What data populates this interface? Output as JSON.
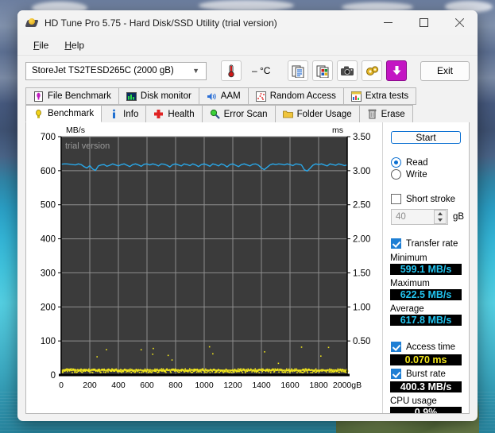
{
  "window": {
    "title": "HD Tune Pro 5.75 - Hard Disk/SSD Utility (trial version)",
    "app_icon": "hard-disk-icon",
    "controls": {
      "minimize": "–",
      "maximize": "□",
      "close": "✕"
    }
  },
  "menubar": {
    "items": [
      {
        "label": "File",
        "accel": "F"
      },
      {
        "label": "Help",
        "accel": "H"
      }
    ]
  },
  "toolbar": {
    "drive": {
      "value": "StoreJet TS2TESD265C (2000 gB)",
      "chevron": "chevron-down-icon"
    },
    "temperature": {
      "icon": "thermometer-icon",
      "value": "– °C"
    },
    "buttons": [
      {
        "name": "copy-text-button",
        "icon": "copy-text-icon"
      },
      {
        "name": "copy-image-button",
        "icon": "copy-image-icon"
      },
      {
        "name": "screenshot-button",
        "icon": "camera-icon"
      },
      {
        "name": "settings-button",
        "icon": "gears-icon"
      },
      {
        "name": "download-button",
        "icon": "download-arrow-icon"
      }
    ],
    "exit_label": "Exit"
  },
  "tabs": {
    "row1": [
      {
        "label": "File Benchmark",
        "icon": "file-benchmark-icon",
        "active": false
      },
      {
        "label": "Disk monitor",
        "icon": "bar-chart-icon",
        "active": false
      },
      {
        "label": "AAM",
        "icon": "speaker-icon",
        "active": false
      },
      {
        "label": "Random Access",
        "icon": "scatter-icon",
        "active": false
      },
      {
        "label": "Extra tests",
        "icon": "extra-tests-icon",
        "active": false
      }
    ],
    "row2": [
      {
        "label": "Benchmark",
        "icon": "lightbulb-icon",
        "active": true
      },
      {
        "label": "Info",
        "icon": "info-icon",
        "active": false
      },
      {
        "label": "Health",
        "icon": "red-cross-icon",
        "active": false
      },
      {
        "label": "Error Scan",
        "icon": "magnifier-icon",
        "active": false
      },
      {
        "label": "Folder Usage",
        "icon": "folder-icon",
        "active": false
      },
      {
        "label": "Erase",
        "icon": "trash-icon",
        "active": false
      }
    ]
  },
  "panel": {
    "start_label": "Start",
    "mode": {
      "read_label": "Read",
      "write_label": "Write",
      "selected": "Read"
    },
    "short_stroke": {
      "label": "Short stroke",
      "checked": false,
      "value": "40",
      "unit": "gB"
    },
    "transfer_rate": {
      "label": "Transfer rate",
      "checked": true
    },
    "minimum": {
      "label": "Minimum",
      "value": "599.1 MB/s",
      "color": "#22c4f0"
    },
    "maximum": {
      "label": "Maximum",
      "value": "622.5 MB/s",
      "color": "#22c4f0"
    },
    "average": {
      "label": "Average",
      "value": "617.8 MB/s",
      "color": "#22c4f0"
    },
    "access_time": {
      "label": "Access time",
      "checked": true,
      "value": "0.070 ms",
      "color": "#f2e61c"
    },
    "burst_rate": {
      "label": "Burst rate",
      "checked": true,
      "value": "400.3 MB/s",
      "color": "#ffffff"
    },
    "cpu_usage": {
      "label": "CPU usage",
      "value": "0.9%",
      "color": "#ffffff"
    }
  },
  "chart_data": {
    "type": "line",
    "title": "",
    "watermark": "trial version",
    "xlabel": "",
    "x_unit": "gB",
    "xlim": [
      0,
      2000
    ],
    "x_ticks": [
      0,
      200,
      400,
      600,
      800,
      1000,
      1200,
      1400,
      1600,
      1800,
      2000
    ],
    "x_tick_labels": [
      "0",
      "200",
      "400",
      "600",
      "800",
      "1000",
      "1200",
      "1400",
      "1600",
      "1800",
      "2000gB"
    ],
    "left_axis": {
      "label": "MB/s",
      "ylim": [
        0,
        700
      ],
      "ticks": [
        100,
        200,
        300,
        400,
        500,
        600,
        700
      ],
      "tick_labels": [
        "100",
        "200",
        "300",
        "400",
        "500",
        "600",
        "700"
      ]
    },
    "right_axis": {
      "label": "ms",
      "ylim": [
        0,
        3.5
      ],
      "ticks": [
        0.5,
        1.0,
        1.5,
        2.0,
        2.5,
        3.0,
        3.5
      ],
      "tick_labels": [
        "0.50",
        "1.00",
        "1.50",
        "2.00",
        "2.50",
        "3.00",
        "3.50"
      ]
    },
    "grid": true,
    "plot_background": "#3b3b3b",
    "series": [
      {
        "name": "Transfer rate",
        "type": "line",
        "axis": "left",
        "color": "#29a7e8",
        "unit": "MB/s",
        "x": [
          0,
          20,
          40,
          60,
          80,
          100,
          120,
          140,
          160,
          180,
          200,
          220,
          240,
          260,
          280,
          300,
          320,
          340,
          360,
          380,
          400,
          420,
          440,
          460,
          480,
          500,
          520,
          540,
          560,
          580,
          600,
          620,
          640,
          660,
          680,
          700,
          720,
          740,
          760,
          780,
          800,
          820,
          840,
          860,
          880,
          900,
          920,
          940,
          960,
          980,
          1000,
          1020,
          1040,
          1060,
          1080,
          1100,
          1120,
          1140,
          1160,
          1180,
          1200,
          1220,
          1240,
          1260,
          1280,
          1300,
          1320,
          1340,
          1360,
          1380,
          1400,
          1420,
          1440,
          1460,
          1480,
          1500,
          1520,
          1540,
          1560,
          1580,
          1600,
          1620,
          1640,
          1660,
          1680,
          1700,
          1720,
          1740,
          1760,
          1780,
          1800,
          1820,
          1840,
          1860,
          1880,
          1900,
          1920,
          1940,
          1960,
          1980,
          2000
        ],
        "y": [
          619,
          620,
          620,
          619,
          618,
          617,
          620,
          618,
          612,
          608,
          615,
          605,
          601,
          614,
          617,
          618,
          613,
          616,
          620,
          617,
          614,
          618,
          620,
          616,
          612,
          618,
          620,
          617,
          613,
          619,
          620,
          617,
          620,
          618,
          614,
          620,
          619,
          616,
          611,
          618,
          620,
          617,
          614,
          620,
          618,
          615,
          620,
          617,
          612,
          618,
          620,
          617,
          613,
          620,
          618,
          614,
          620,
          617,
          611,
          618,
          620,
          616,
          612,
          618,
          620,
          617,
          614,
          619,
          620,
          616,
          608,
          603,
          610,
          617,
          620,
          618,
          620,
          619,
          617,
          620,
          618,
          615,
          620,
          619,
          617,
          603,
          599,
          607,
          616,
          620,
          618,
          620,
          617,
          614,
          620,
          618,
          616,
          620,
          618,
          615,
          617
        ]
      },
      {
        "name": "Access time",
        "type": "scatter",
        "axis": "right",
        "color": "#f2e61c",
        "unit": "ms",
        "average": 0.07,
        "note": "Dense point cloud along the 0.05-0.10 ms baseline with sparse outlier spikes reaching 0.25-0.45 ms"
      }
    ]
  }
}
